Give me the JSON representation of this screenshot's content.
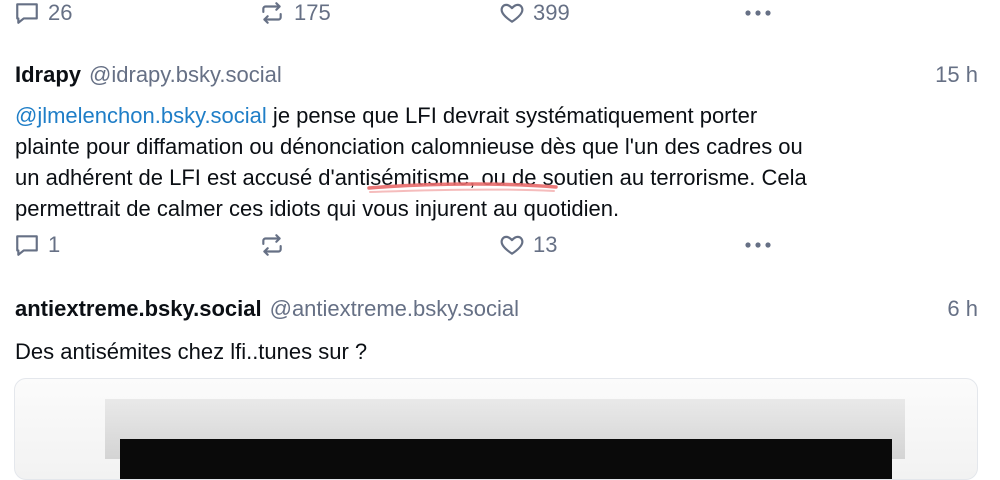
{
  "post1": {
    "actions": {
      "replies": "26",
      "reposts": "175",
      "likes": "399"
    }
  },
  "post2": {
    "display_name": "Idrapy",
    "handle": "@idrapy.bsky.social",
    "time": "15 h",
    "mention": "@jlmelenchon.bsky.social",
    "lines": [
      " je pense que LFI devrait systématiquement porter",
      "plainte pour diffamation ou dénonciation calomnieuse dès que l'un des cadres ou",
      "un adhérent de LFI est accusé d'antisémitisme, ou de soutien au terrorisme. Cela",
      "permettrait de calmer ces idiots qui vous injurent au quotidien."
    ],
    "actions": {
      "replies": "1",
      "reposts": "",
      "likes": "13"
    }
  },
  "post3": {
    "display_name": "antiextreme.bsky.social",
    "handle": "@antiextreme.bsky.social",
    "time": "6 h",
    "text": "Des antisémites chez lfi..tunes sur ?"
  },
  "colors": {
    "accent_link": "#1f7ec7",
    "muted": "#667085",
    "annotation_underline": "#e86a6a"
  },
  "icons": [
    "reply-icon",
    "repost-icon",
    "like-icon",
    "more-icon"
  ]
}
